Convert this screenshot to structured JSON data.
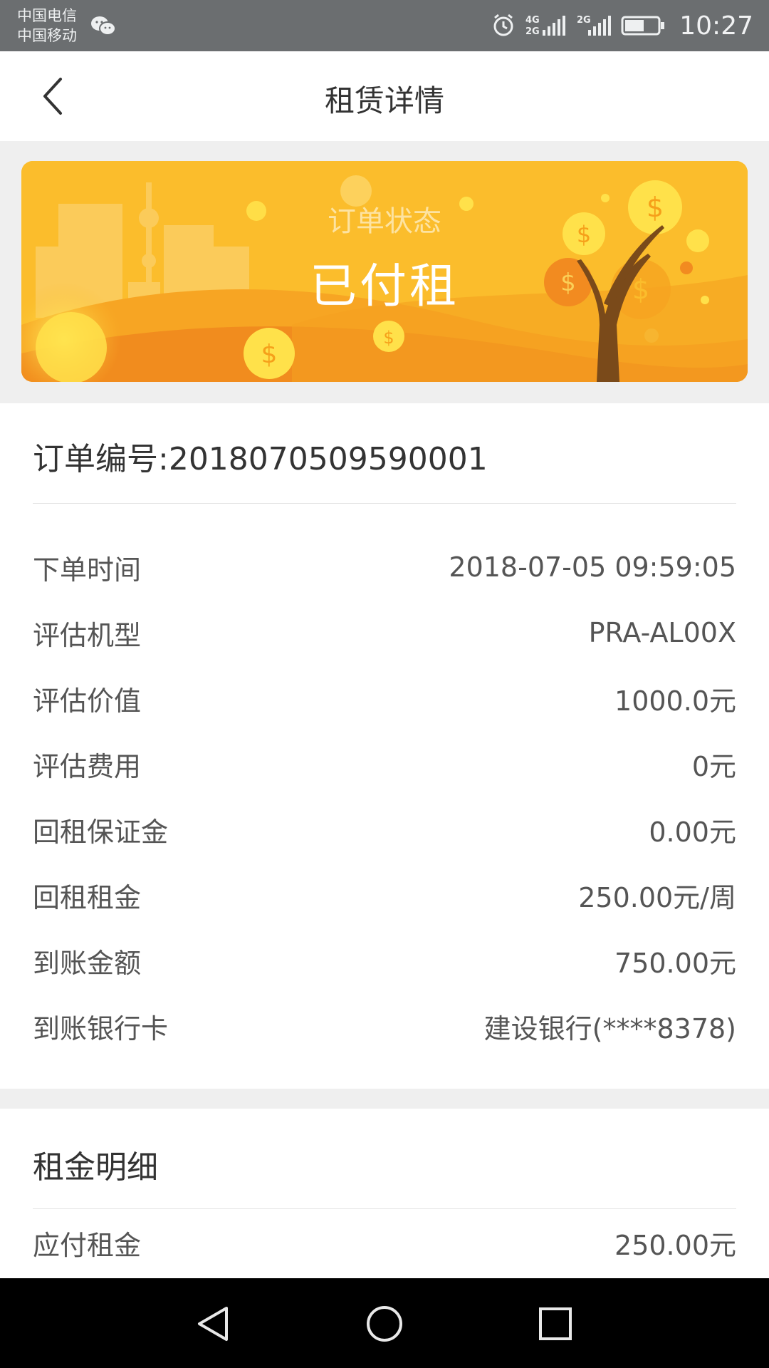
{
  "status_bar": {
    "carrier1": "中国电信",
    "carrier2": "中国移动",
    "network1": "4G 2G",
    "network2": "2G",
    "time": "10:27"
  },
  "header": {
    "title": "租赁详情"
  },
  "banner": {
    "label": "订单状态",
    "status": "已付租"
  },
  "order": {
    "number_label": "订单编号:2018070509590001",
    "rows": [
      {
        "label": "下单时间",
        "value": "2018-07-05 09:59:05"
      },
      {
        "label": "评估机型",
        "value": "PRA-AL00X"
      },
      {
        "label": "评估价值",
        "value": "1000.0元"
      },
      {
        "label": "评估费用",
        "value": "0元"
      },
      {
        "label": "回租保证金",
        "value": "0.00元"
      },
      {
        "label": "回租租金",
        "value": "250.00元/周"
      },
      {
        "label": "到账金额",
        "value": "750.00元"
      },
      {
        "label": "到账银行卡",
        "value": "建设银行(****8378)"
      }
    ]
  },
  "rent_detail": {
    "title": "租金明细",
    "rows": [
      {
        "label": "应付租金",
        "value": "250.00元"
      }
    ]
  },
  "colors": {
    "banner_bg": "#fbbd2c",
    "status_bar": "#6b6e70",
    "page_bg": "#efefef"
  }
}
